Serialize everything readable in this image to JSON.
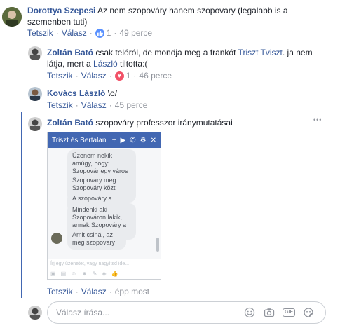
{
  "comments": [
    {
      "author": "Dorottya Szepesi",
      "text": "Az nem szopováry hanem szopovary (legalabb is a szemenben tuti)",
      "actions": {
        "like": "Tetszik",
        "reply": "Válasz"
      },
      "reaction_count": "1",
      "time": "49 perce"
    },
    {
      "author": "Zoltán Bató",
      "text_before": " csak telóról, de mondja meg a frankót ",
      "mention1": "Triszt Tviszt",
      "text_mid": ". ja nem látja, mert a ",
      "mention2": "László",
      "text_after": " tiltotta:(",
      "actions": {
        "like": "Tetszik",
        "reply": "Válasz"
      },
      "reaction_count": "1",
      "time": "46 perce"
    },
    {
      "author": "Kovács László",
      "text": "\\o/",
      "actions": {
        "like": "Tetszik",
        "reply": "Válasz"
      },
      "time": "45 perce"
    },
    {
      "author": "Zoltán Bató",
      "text": "szopováry professzor iránymutatásai",
      "actions": {
        "like": "Tetszik",
        "reply": "Válasz"
      },
      "time": "épp most",
      "more": "•••"
    }
  ],
  "chat_screenshot": {
    "title": "Triszt és Bertalan",
    "messages": [
      "Üzenem nekik amúgy, hogy: Szopovár egy város és state of mind",
      "Szopovary meg Szopováry közt nincs különbség",
      "A szopóváry a helytelen",
      "Mindenki aki Szopováron lakik, annak Szopováry a vezetékneve",
      "Amit csinál, az meg szopovary"
    ],
    "input_placeholder": "Írj egy üzenetet, vagy nagyítsd ide..."
  },
  "reply_box": {
    "placeholder": "Válasz írása...",
    "gif_label": "GIF"
  },
  "colors": {
    "link": "#365899",
    "messenger_blue": "#4267b2",
    "like_blue": "#5890ff",
    "love_red": "#f25268"
  }
}
